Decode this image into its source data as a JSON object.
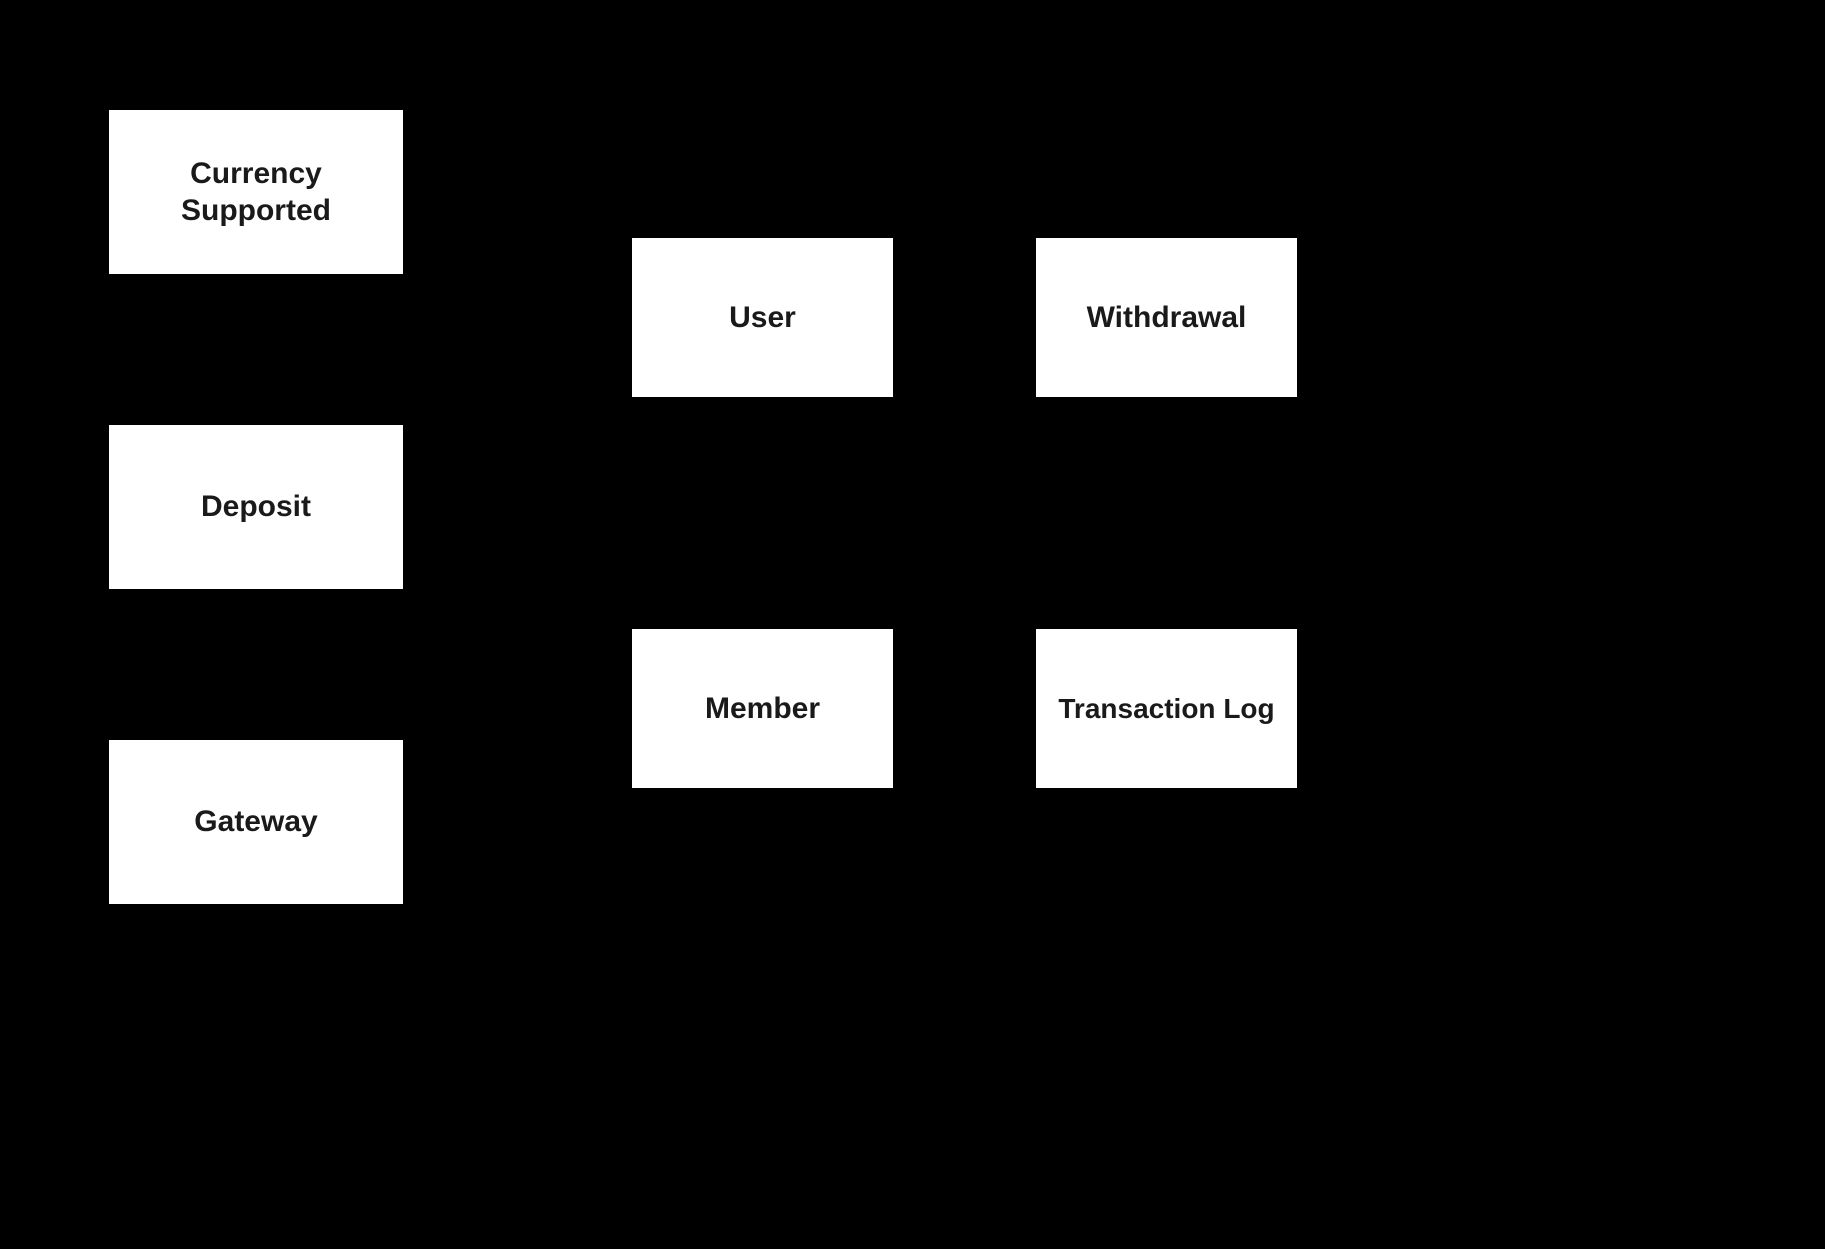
{
  "diagram": {
    "boxes": {
      "currency_supported": "Currency Supported",
      "deposit": "Deposit",
      "gateway": "Gateway",
      "user": "User",
      "withdrawal": "Withdrawal",
      "member": "Member",
      "transaction_log": "Transaction Log"
    }
  }
}
